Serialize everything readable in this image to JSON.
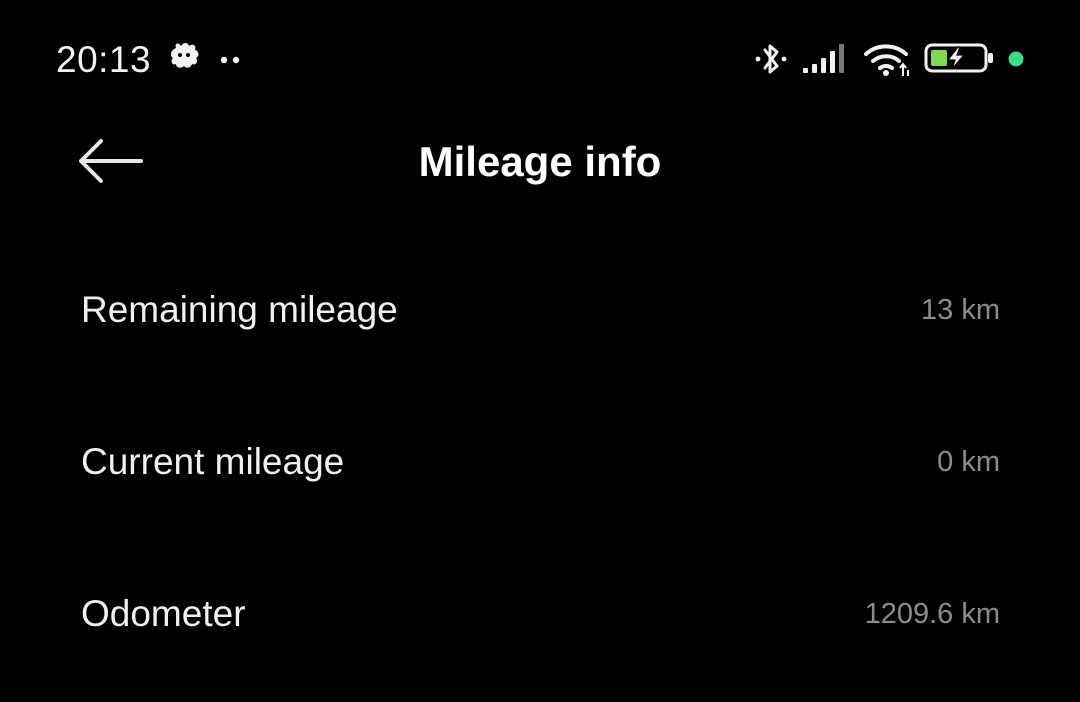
{
  "status_bar": {
    "time": "20:13",
    "icons": {
      "left": [
        "bug-notification-icon",
        "more-notifications-dots-icon"
      ],
      "right": [
        "bluetooth-icon",
        "cellular-signal-icon",
        "wifi-icon",
        "battery-charging-icon",
        "status-dot-icon"
      ]
    },
    "colors": {
      "battery_fill": "#7ed957",
      "status_dot": "#3ddc84"
    }
  },
  "header": {
    "title": "Mileage info",
    "back_icon": "arrow-left-icon"
  },
  "rows": [
    {
      "label": "Remaining mileage",
      "value": "13 km"
    },
    {
      "label": "Current mileage",
      "value": "0 km"
    },
    {
      "label": "Odometer",
      "value": "1209.6 km"
    }
  ]
}
